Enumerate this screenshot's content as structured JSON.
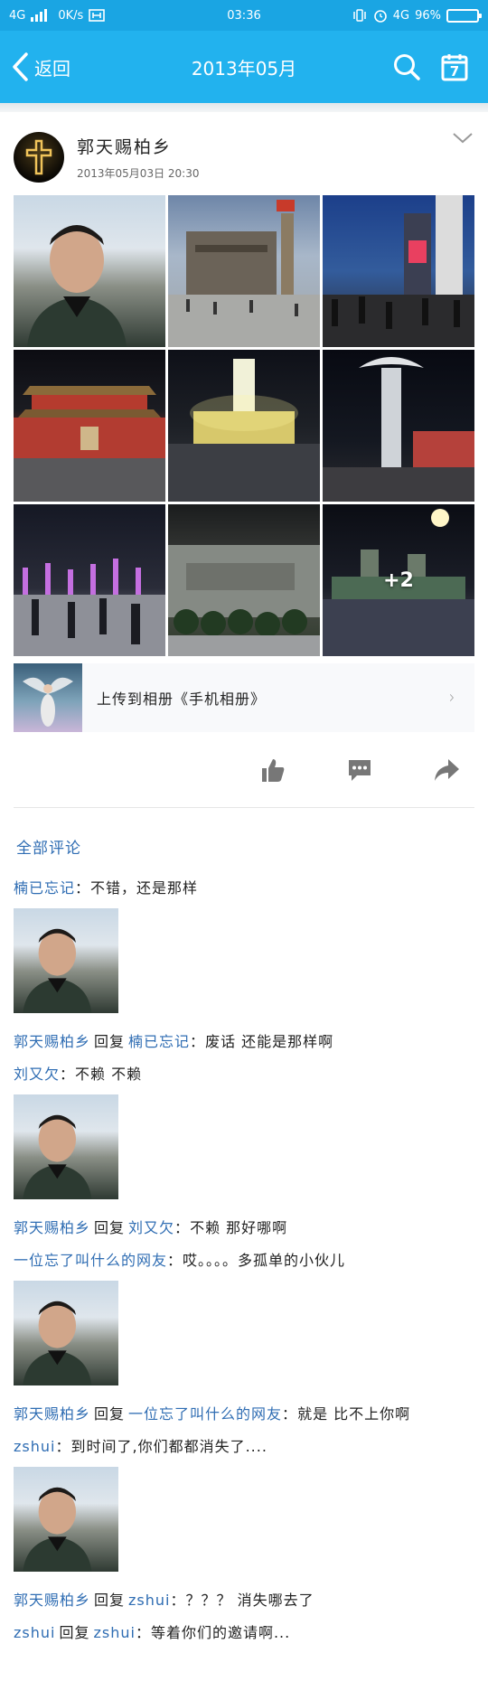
{
  "status": {
    "network_left": "4G",
    "speed": "0K/s",
    "time": "03:36",
    "network_right": "4G",
    "battery": "96%",
    "battery_level": 0.96
  },
  "header": {
    "back_label": "返回",
    "title": "2013年05月",
    "calendar_day": "7"
  },
  "post": {
    "author": "郭天赐柏乡",
    "time": "2013年05月03日 20:30",
    "more_count": "+2",
    "album_text": "上传到相册《手机相册》"
  },
  "comments": {
    "title": "全部评论",
    "reply_word": "回复",
    "items": [
      {
        "name": "楠已忘记",
        "text": "不错，还是那样"
      },
      {
        "name": "郭天赐柏乡",
        "target": "楠已忘记",
        "text": "废话 还能是那样啊"
      },
      {
        "name": "刘又欠",
        "text": "不赖 不赖"
      },
      {
        "name": "郭天赐柏乡",
        "target": "刘又欠",
        "text": "不赖 那好哪啊"
      },
      {
        "name": "一位忘了叫什么的网友",
        "text": "哎。。。。多孤单的小伙儿"
      },
      {
        "name": "郭天赐柏乡",
        "target": "一位忘了叫什么的网友",
        "text": "就是 比不上你啊"
      },
      {
        "name": "zshui",
        "text": "到时间了,你们都都消失了...."
      },
      {
        "name": "郭天赐柏乡",
        "target": "zshui",
        "text": "？？？ 消失哪去了"
      },
      {
        "name": "zshui",
        "target": "zshui",
        "text": "等着你们的邀请啊..."
      }
    ]
  },
  "colors": {
    "header": "#22b2ee",
    "status_bar": "#1aa5e3",
    "link": "#2f6db3"
  },
  "icons": [
    "back-chevron-icon",
    "search-icon",
    "calendar-icon",
    "chevron-down-icon",
    "like-icon",
    "comment-icon",
    "share-icon",
    "chevron-right-icon"
  ]
}
